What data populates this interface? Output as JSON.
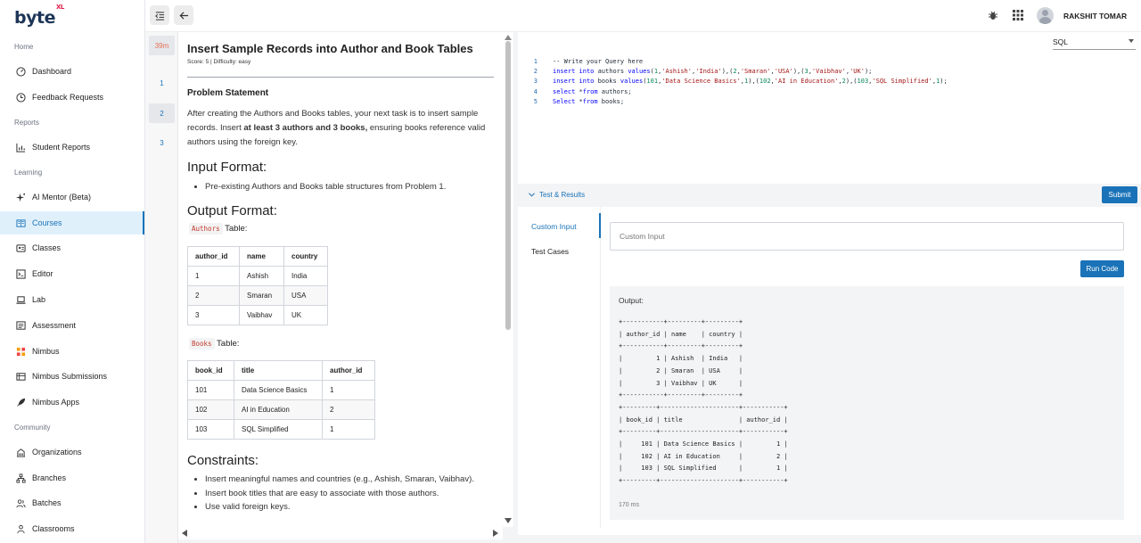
{
  "brand": {
    "logo": "byte",
    "logo_sup": "XL"
  },
  "sidebar": {
    "sections": [
      {
        "label": "Home"
      },
      {
        "label": "Reports"
      },
      {
        "label": "Learning"
      },
      {
        "label": "Community"
      }
    ],
    "items": [
      {
        "label": "Dashboard",
        "icon": "dashboard-icon"
      },
      {
        "label": "Feedback Requests",
        "icon": "history-icon"
      },
      {
        "label": "Student Reports",
        "icon": "bar-chart-icon"
      },
      {
        "label": "AI Mentor (Beta)",
        "icon": "sparkle-icon"
      },
      {
        "label": "Courses",
        "icon": "book-open-icon",
        "active": true
      },
      {
        "label": "Classes",
        "icon": "classes-icon"
      },
      {
        "label": "Editor",
        "icon": "terminal-icon"
      },
      {
        "label": "Lab",
        "icon": "laptop-icon"
      },
      {
        "label": "Assessment",
        "icon": "assessment-icon"
      },
      {
        "label": "Nimbus",
        "icon": "nimbus-icon"
      },
      {
        "label": "Nimbus Submissions",
        "icon": "submissions-icon"
      },
      {
        "label": "Nimbus Apps",
        "icon": "rocket-icon"
      },
      {
        "label": "Organizations",
        "icon": "building-icon"
      },
      {
        "label": "Branches",
        "icon": "branches-icon"
      },
      {
        "label": "Batches",
        "icon": "users-icon"
      },
      {
        "label": "Classrooms",
        "icon": "classroom-icon"
      }
    ]
  },
  "topbar": {
    "username": "RAKSHIT TOMAR"
  },
  "rail": {
    "timer": "39m",
    "questions": [
      "1",
      "2",
      "3"
    ],
    "active_question": "2"
  },
  "problem": {
    "title": "Insert Sample Records into Author and Book Tables",
    "meta": "Score: 5 | Difficulty: easy",
    "statement_heading": "Problem Statement",
    "statement_pre": "After creating the Authors and Books tables, your next task is to insert sample records. Insert ",
    "statement_bold": "at least 3 authors and 3 books,",
    "statement_post": " ensuring books reference valid authors using the foreign key.",
    "input_heading": "Input Format:",
    "input_items": [
      "Pre-existing Authors and Books table structures from Problem 1."
    ],
    "output_heading": "Output Format:",
    "authors_tag": "Authors",
    "books_tag": "Books",
    "table_word": "Table:",
    "authors_table": {
      "headers": [
        "author_id",
        "name",
        "country"
      ],
      "rows": [
        [
          "1",
          "Ashish",
          "India"
        ],
        [
          "2",
          "Smaran",
          "USA"
        ],
        [
          "3",
          "Vaibhav",
          "UK"
        ]
      ]
    },
    "books_table": {
      "headers": [
        "book_id",
        "title",
        "author_id"
      ],
      "rows": [
        [
          "101",
          "Data Science Basics",
          "1"
        ],
        [
          "102",
          "AI in Education",
          "2"
        ],
        [
          "103",
          "SQL Simplified",
          "1"
        ]
      ]
    },
    "constraints_heading": "Constraints:",
    "constraints": [
      "Insert meaningful names and countries (e.g., Ashish, Smaran, Vaibhav).",
      "Insert book titles that are easy to associate with those authors.",
      "Use valid foreign keys."
    ]
  },
  "editor": {
    "language": "SQL",
    "line_numbers": [
      "1",
      "2",
      "3",
      "4",
      "5"
    ],
    "lines": [
      "-- Write your Query here",
      "insert into authors values(1,'Ashish','India'),(2,'Smaran','USA'),(3,'Vaibhav','UK');",
      "insert into books values(101,'Data Science Basics',1),(102,'AI in Education',2),(103,'SQL Simplified',1);",
      "select *from authors;",
      "Select *from books;"
    ]
  },
  "results": {
    "toggle_label": "Test & Results",
    "submit_label": "Submit",
    "tabs": [
      "Custom Input",
      "Test Cases"
    ],
    "custom_input_placeholder": "Custom Input",
    "run_label": "Run Code",
    "output_label": "Output:",
    "output_text": "+-----------+---------+---------+\n| author_id | name    | country |\n+-----------+---------+---------+\n|         1 | Ashish  | India   |\n|         2 | Smaran  | USA     |\n|         3 | Vaibhav | UK      |\n+-----------+---------+---------+\n+---------+---------------------+-----------+\n| book_id | title               | author_id |\n+---------+---------------------+-----------+\n|     101 | Data Science Basics |         1 |\n|     102 | AI in Education     |         2 |\n|     103 | SQL Simplified      |         1 |\n+---------+---------------------+-----------+",
    "time": "170 ms"
  },
  "colors": {
    "accent": "#1a73b8",
    "timer": "#e76f51",
    "code_tag": "#c0392b"
  }
}
